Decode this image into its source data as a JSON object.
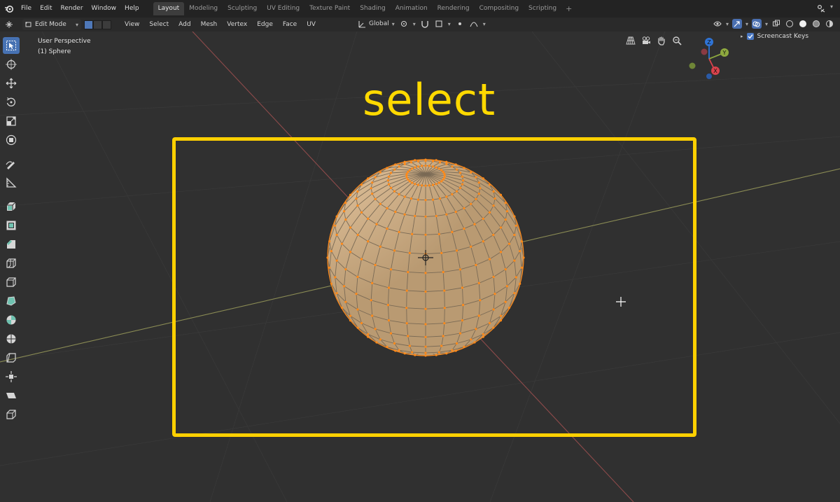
{
  "app": "Blender",
  "topbar": {
    "menu": [
      "File",
      "Edit",
      "Render",
      "Window",
      "Help"
    ],
    "workspaces": [
      {
        "label": "Layout",
        "active": true
      },
      {
        "label": "Modeling",
        "active": false
      },
      {
        "label": "Sculpting",
        "active": false
      },
      {
        "label": "UV Editing",
        "active": false
      },
      {
        "label": "Texture Paint",
        "active": false
      },
      {
        "label": "Shading",
        "active": false
      },
      {
        "label": "Animation",
        "active": false
      },
      {
        "label": "Rendering",
        "active": false
      },
      {
        "label": "Compositing",
        "active": false
      },
      {
        "label": "Scripting",
        "active": false
      }
    ],
    "add_tab": "+"
  },
  "header": {
    "mode": "Edit Mode",
    "menu": [
      "View",
      "Select",
      "Add",
      "Mesh",
      "Vertex",
      "Edge",
      "Face",
      "UV"
    ],
    "transform_orientation": "Global"
  },
  "viewport": {
    "view_name": "User Perspective",
    "object_name": "(1) Sphere",
    "overlay_text": "select",
    "screencast_keys_label": "Screencast Keys",
    "screencast_keys_enabled": true,
    "gizmo_axes": {
      "x": "X",
      "y": "Y",
      "z": "Z"
    }
  },
  "colors": {
    "accent_blue": "#4772b3",
    "highlight_yellow": "#ffd000",
    "selected_vertex": "#ff8a1a",
    "sphere": "#d4b58e"
  },
  "icons": {
    "toolbar": [
      "select-box-icon",
      "cursor-icon",
      "move-icon",
      "rotate-icon",
      "scale-icon",
      "transform-icon",
      "annotate-icon",
      "measure-icon",
      "extrude-icon",
      "inset-icon",
      "bevel-icon",
      "loop-cut-icon",
      "knife-icon",
      "poly-build-icon",
      "spin-icon",
      "smooth-icon",
      "edge-slide-icon",
      "shrink-fatten-icon",
      "shear-icon",
      "rip-icon"
    ]
  }
}
